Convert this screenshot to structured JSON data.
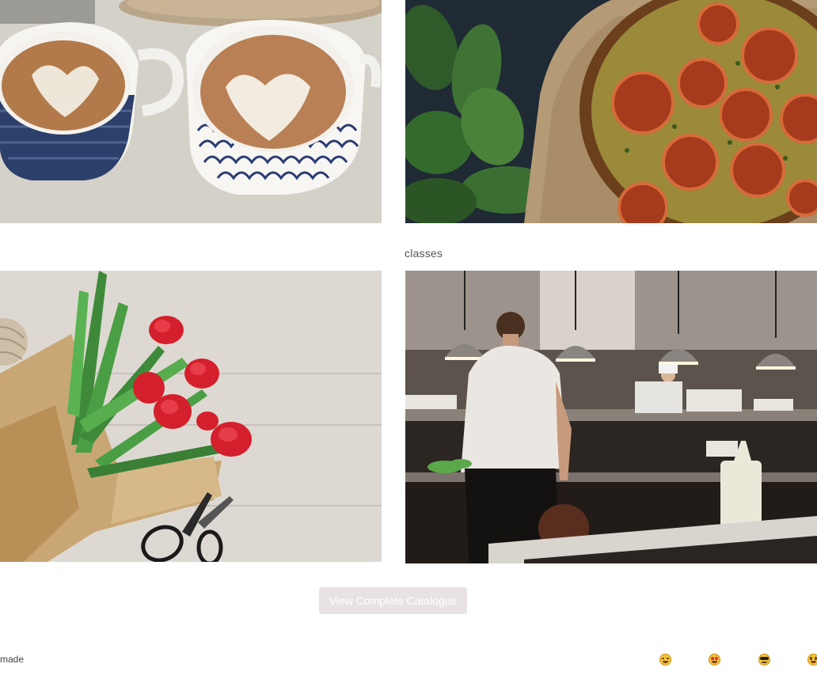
{
  "gallery": {
    "tiles": [
      {
        "icon": "latte-art-photo"
      },
      {
        "icon": "tomato-tart-photo"
      },
      {
        "icon": "tulip-bouquet-photo"
      },
      {
        "icon": "restaurant-kitchen-photo"
      }
    ],
    "caption": "classes"
  },
  "catalogue_button": {
    "label": "View Complete Catalogue",
    "bg_color": "#e8e2e4",
    "text_color": "#ffffff"
  },
  "footer": {
    "text": "made",
    "emojis": [
      "rolling-laughing-emoji",
      "heart-eyes-emoji",
      "sunglasses-emoji",
      "grinning-emoji"
    ]
  }
}
